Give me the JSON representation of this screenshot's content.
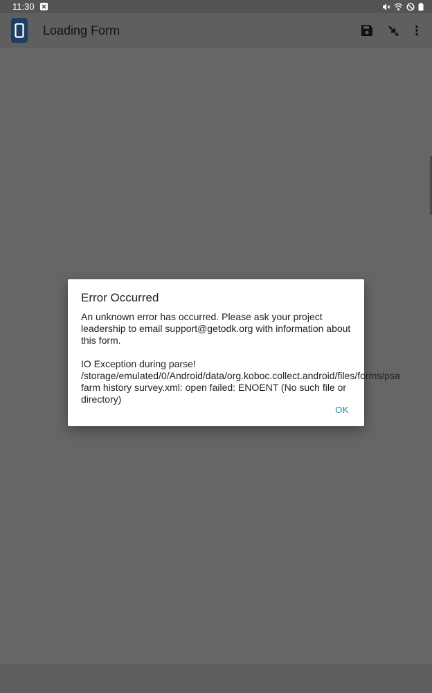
{
  "status_bar": {
    "time": "11:30"
  },
  "app_bar": {
    "title": "Loading Form",
    "icons": [
      "app-logo-icon",
      "save-icon",
      "goto-icon",
      "more-vert-icon"
    ]
  },
  "dialog": {
    "title": "Error Occurred",
    "message": "An unknown error has occurred. Please ask your project leadership to email support@getodk.org with information about this form.\n\nIO Exception during parse! /storage/emulated/0/Android/data/org.koboc.collect.android/files/forms/psa farm history survey.xml: open failed: ENOENT (No such file or directory)",
    "ok_label": "OK"
  },
  "colors": {
    "accent": "#1a86a8",
    "scrim": "#666666",
    "logo": "#1e3e63"
  }
}
